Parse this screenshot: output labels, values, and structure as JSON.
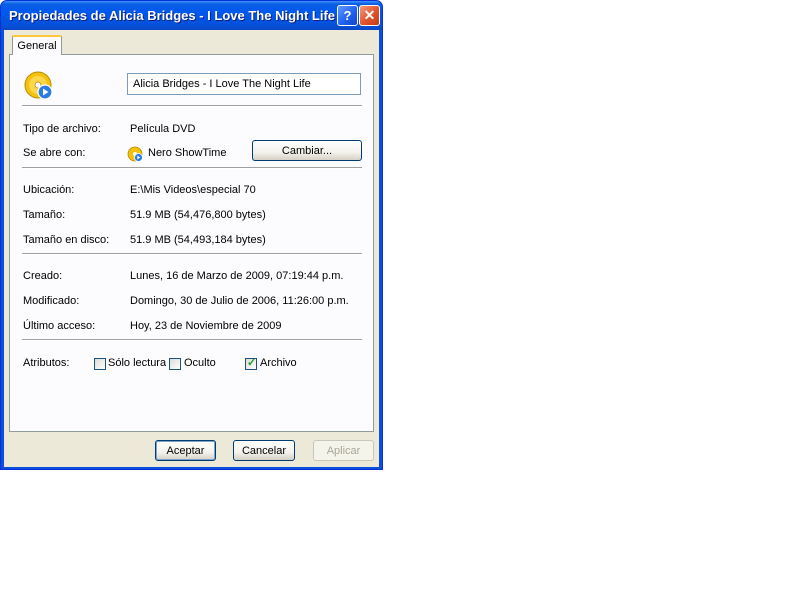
{
  "window": {
    "title": "Propiedades de Alicia Bridges - I Love The Night Life",
    "help_glyph": "?",
    "close_glyph": "✕"
  },
  "tabs": [
    {
      "label": "General"
    }
  ],
  "general": {
    "file_name": "Alicia Bridges - I Love The Night Life",
    "rows": {
      "type_label": "Tipo de archivo:",
      "type_value": "Película DVD",
      "opens_label": "Se abre con:",
      "opens_value": "Nero ShowTime",
      "change_button": "Cambiar...",
      "location_label": "Ubicación:",
      "location_value": "E:\\Mis Videos\\especial 70",
      "size_label": "Tamaño:",
      "size_value": "51.9 MB (54,476,800 bytes)",
      "disk_size_label": "Tamaño en disco:",
      "disk_size_value": "51.9 MB (54,493,184 bytes)",
      "created_label": "Creado:",
      "created_value": "Lunes, 16 de Marzo de 2009, 07:19:44 p.m.",
      "modified_label": "Modificado:",
      "modified_value": "Domingo, 30 de Julio de 2006, 11:26:00 p.m.",
      "accessed_label": "Último acceso:",
      "accessed_value": "Hoy, 23 de Noviembre de 2009"
    },
    "attributes": {
      "label": "Atributos:",
      "readonly": {
        "label": "Sólo lectura",
        "checked": false
      },
      "hidden": {
        "label": "Oculto",
        "checked": false
      },
      "archive": {
        "label": "Archivo",
        "checked": true
      }
    }
  },
  "footer": {
    "ok": "Aceptar",
    "cancel": "Cancelar",
    "apply": "Aplicar"
  },
  "icons": {
    "file_icon": "dvd-movie-icon",
    "app_icon": "nero-showtime-icon"
  }
}
